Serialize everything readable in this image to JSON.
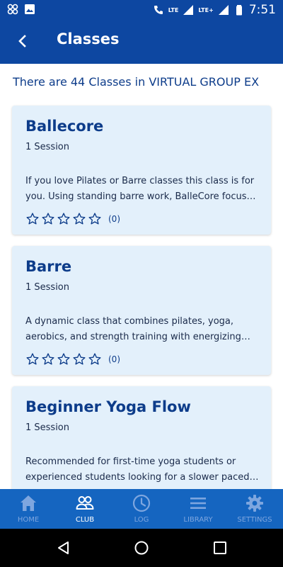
{
  "status_bar": {
    "network_labels": [
      "LTE",
      "LTE+"
    ],
    "time": "7:51"
  },
  "app_bar": {
    "title": "Classes"
  },
  "summary": "There are 44 Classes in VIRTUAL GROUP EX",
  "classes": [
    {
      "name": "Ballecore",
      "sessions": "1 Session",
      "description": "If you love Pilates or Barre classes this class is for you. Using standing barre work, BalleCore focuses on core...",
      "rating_count": "(0)",
      "stars": 0
    },
    {
      "name": "Barre",
      "sessions": "1 Session",
      "description": "A dynamic class that combines pilates, yoga, aerobics, and strength training with energizing music, resulting ...",
      "rating_count": "(0)",
      "stars": 0
    },
    {
      "name": "Beginner Yoga Flow",
      "sessions": "1 Session",
      "description": "Recommended for first-time yoga students or experienced students looking for a slower paced and ...",
      "rating_count": "",
      "stars": 0
    }
  ],
  "bottom_nav": [
    {
      "label": "HOME",
      "icon": "home-icon",
      "active": false
    },
    {
      "label": "CLUB",
      "icon": "people-icon",
      "active": true
    },
    {
      "label": "LOG",
      "icon": "clock-icon",
      "active": false
    },
    {
      "label": "LIBRARY",
      "icon": "menu-lines-icon",
      "active": false
    },
    {
      "label": "SETTINGS",
      "icon": "gear-icon",
      "active": false
    }
  ],
  "colors": {
    "app_bar": "#0d47a1",
    "bottom_nav": "#1565c0",
    "card_bg": "#e3f0fb",
    "title_text": "#0d3c8a",
    "nav_inactive": "#7ea6df",
    "nav_active": "#ffffff"
  }
}
